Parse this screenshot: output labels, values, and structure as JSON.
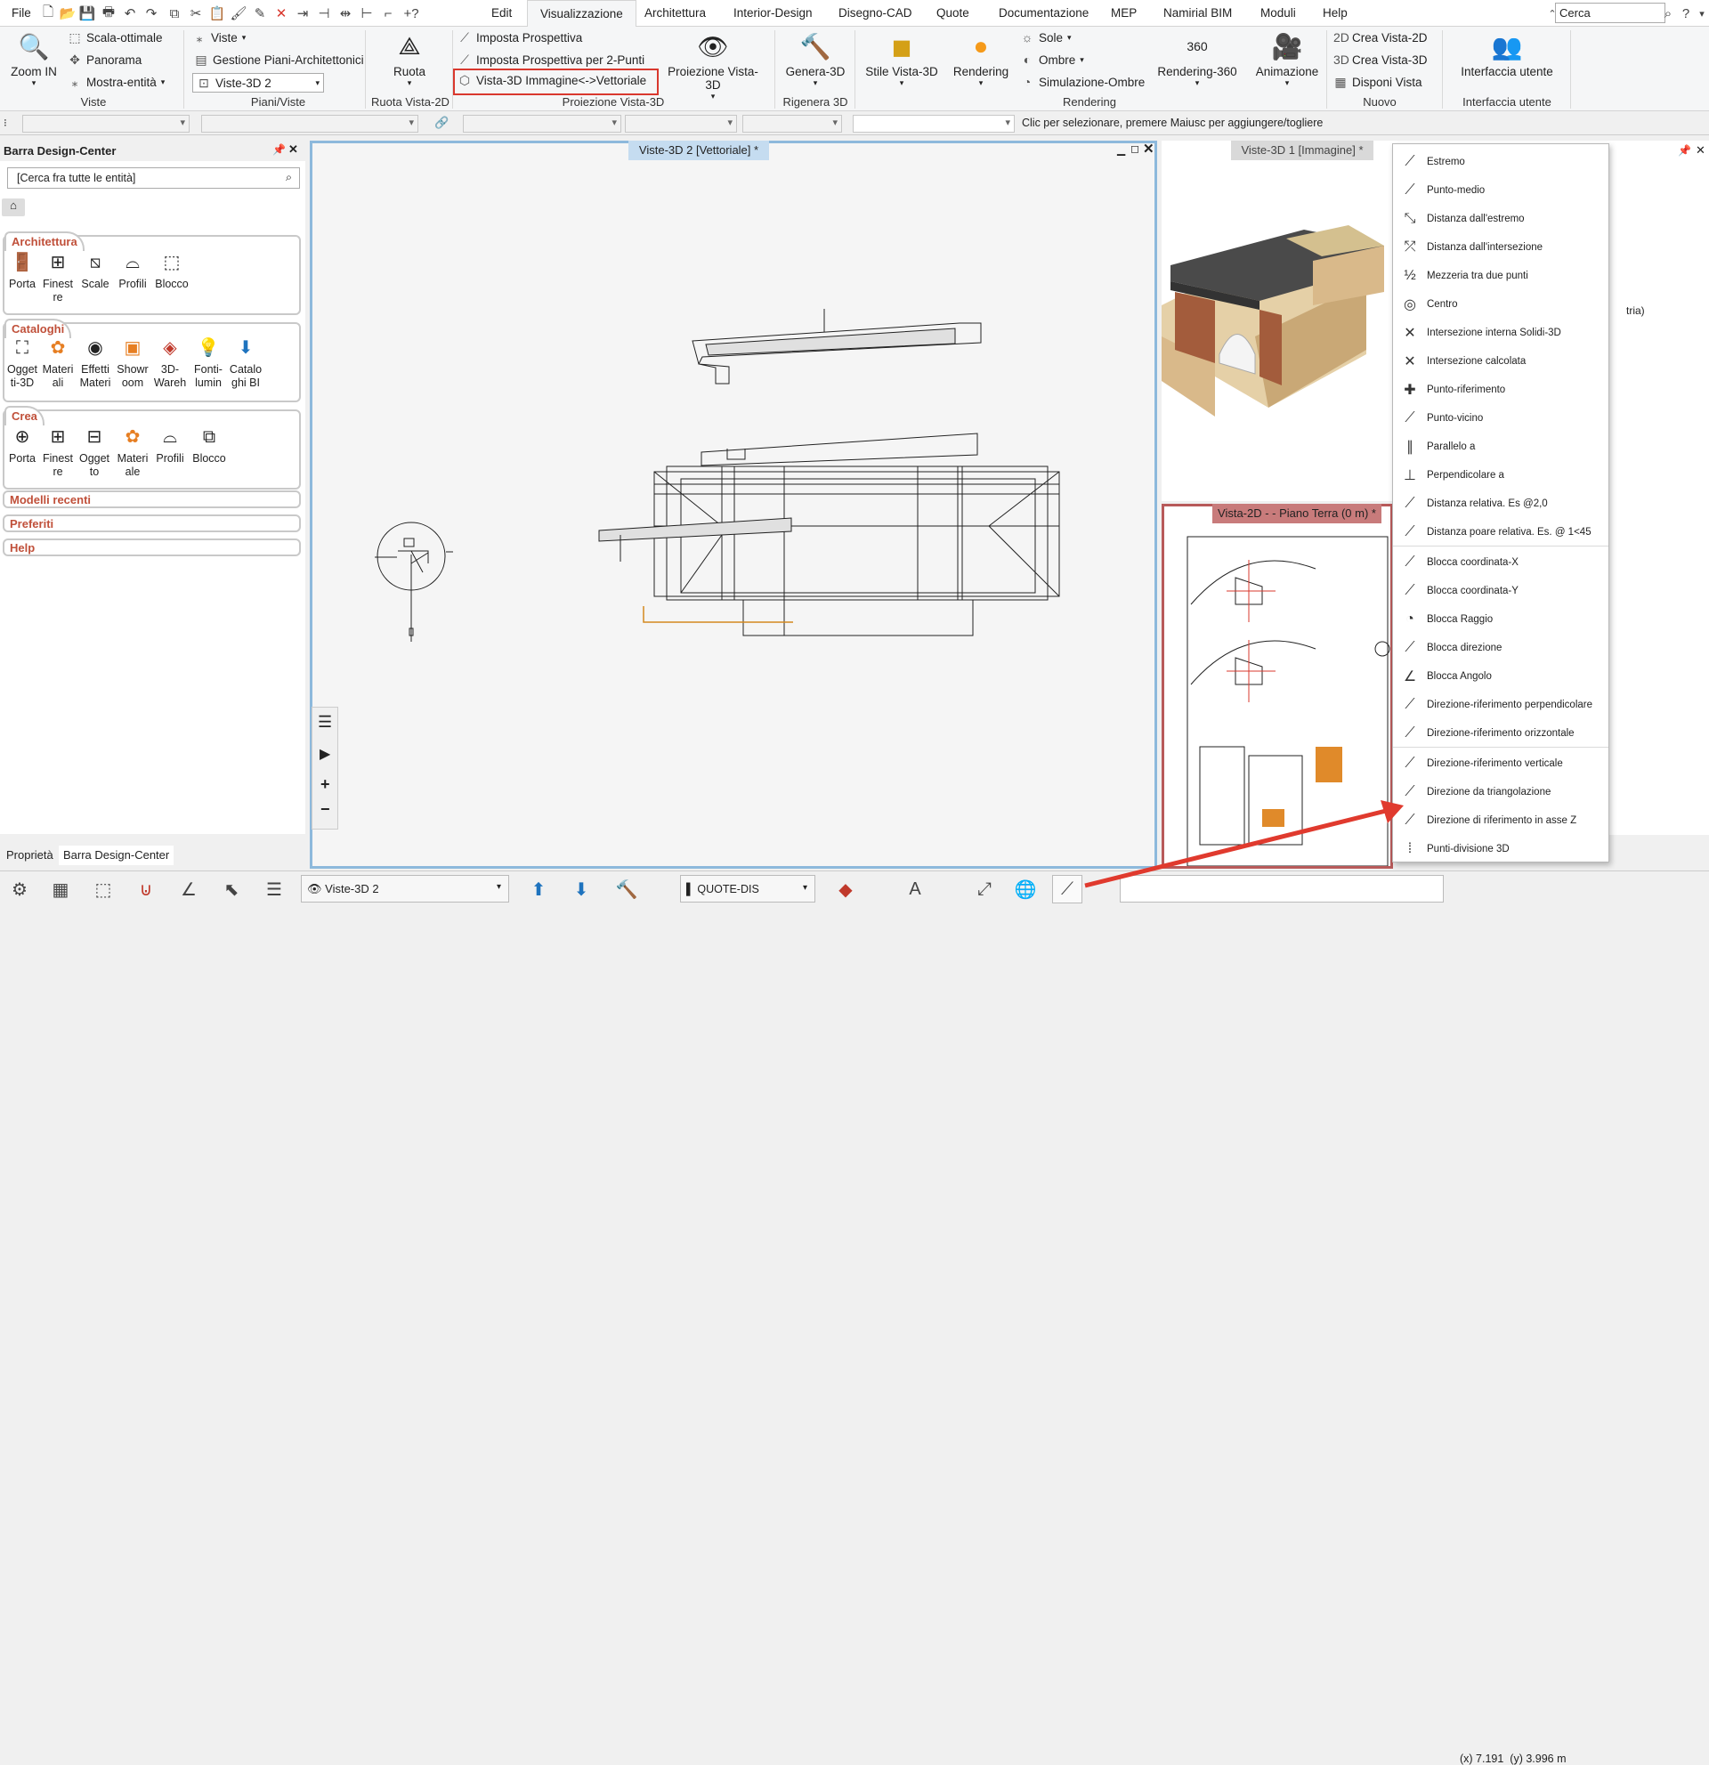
{
  "menubar": {
    "items": [
      "File",
      "Edit",
      "Visualizzazione",
      "Architettura",
      "Interior-Design",
      "Disegno-CAD",
      "Quote",
      "Documentazione",
      "MEP",
      "Namirial BIM",
      "Moduli",
      "Help"
    ],
    "search_placeholder": "Cerca",
    "help": "?"
  },
  "ribbon": {
    "zoom_in": "Zoom IN",
    "scala": "Scala-ottimale",
    "panorama": "Panorama",
    "mostra": "Mostra-entità",
    "viste": "Viste",
    "gestione": "Gestione Piani-Architettonici",
    "viste_combo": "Viste-3D 2",
    "ruota": "Ruota",
    "imposta": "Imposta Prospettiva",
    "imposta2": "Imposta Prospettiva per 2-Punti",
    "vista_imm": "Vista-3D Immagine<->Vettoriale",
    "proiezione": "Proiezione Vista-3D",
    "genera": "Genera-3D",
    "stile": "Stile Vista-3D",
    "rendering": "Rendering",
    "sole": "Sole",
    "ombre": "Ombre",
    "simulazione": "Simulazione-Ombre",
    "rendering360": "Rendering-360",
    "animazione": "Animazione",
    "crea2d": "Crea Vista-2D",
    "crea3d": "Crea Vista-3D",
    "disponi": "Disponi Vista",
    "interfaccia": "Interfaccia utente",
    "groups": [
      "Viste",
      "Piani/Viste",
      "Ruota Vista-2D",
      "Proiezione Vista-3D",
      "Rigenera 3D",
      "Rendering",
      "Nuovo",
      "Interfaccia utente"
    ]
  },
  "optbar": {
    "hint": "Clic per selezionare, premere Maiusc per aggiungere/togliere"
  },
  "design_center": {
    "title": "Barra Design-Center",
    "search": "[Cerca fra tutte le entità]",
    "architettura": {
      "title": "Architettura",
      "items": [
        "Porta",
        "Finest re",
        "Scale",
        "Profili",
        "Blocco"
      ]
    },
    "cataloghi": {
      "title": "Cataloghi",
      "items": [
        "Ogget ti-3D",
        "Materi ali",
        "Effetti Materi",
        "Showr oom",
        "3D-Wareh",
        "Fonti-lumin",
        "Catalo ghi BI"
      ]
    },
    "crea": {
      "title": "Crea",
      "items": [
        "Porta",
        "Finest re",
        "Ogget to",
        "Materi ale",
        "Profili",
        "Blocco"
      ]
    },
    "collapsed": [
      "Modelli recenti",
      "Preferiti",
      "Help"
    ],
    "tabs": [
      "Proprietà",
      "Barra Design-Center"
    ]
  },
  "views": {
    "v1": "Viste-3D 2 [Vettoriale] *",
    "v2": "Viste-3D 1 [Immagine] *",
    "v3": "Vista-2D -  - Piano Terra (0 m) *"
  },
  "right_partial": "tria)",
  "snap_menu": [
    "Estremo",
    "Punto-medio",
    "Distanza dall'estremo",
    "Distanza dall'intersezione",
    "Mezzeria tra due punti",
    "Centro",
    "Intersezione interna Solidi-3D",
    "Intersezione calcolata",
    "Punto-riferimento",
    "Punto-vicino",
    "Parallelo a",
    "Perpendicolare a",
    "Distanza relativa. Es @2,0",
    "Distanza poare relativa. Es. @ 1<45",
    "Blocca coordinata-X",
    "Blocca coordinata-Y",
    "Blocca Raggio",
    "Blocca direzione",
    "Blocca Angolo",
    "Direzione-riferimento perpendicolare",
    "Direzione-riferimento orizzontale",
    "Direzione-riferimento verticale",
    "Direzione da triangolazione",
    "Direzione di riferimento in asse Z",
    "Punti-divisione 3D"
  ],
  "statusbar": {
    "view_combo": "Viste-3D 2",
    "layer": "QUOTE-DIS",
    "coord_x": "(x) 7.191",
    "coord_y": "(y) 3.996 m"
  },
  "colors": {
    "accent": "#1e73be",
    "highlight": "#d9382e",
    "section_title": "#c0503a"
  }
}
